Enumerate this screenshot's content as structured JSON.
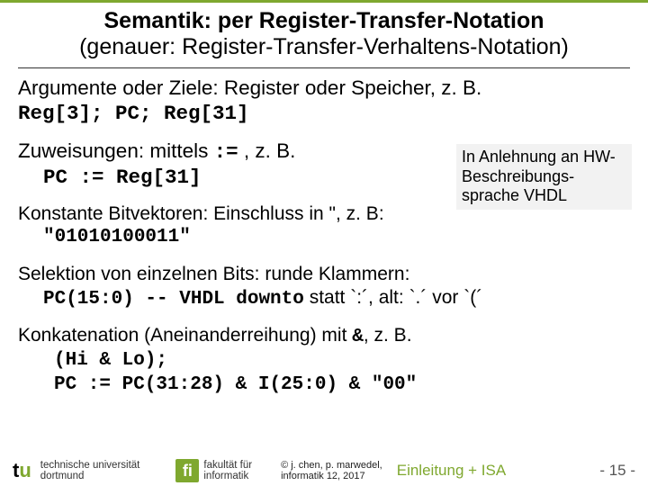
{
  "header": {
    "title": "Semantik: per Register-Transfer-Notation",
    "subtitle": "(genauer: Register-Transfer-Verhaltens-Notation)"
  },
  "body": {
    "args_intro": "Argumente oder Ziele: Register oder Speicher, z. B.",
    "reg_examples": "Reg[3];  PC;   Reg[31]",
    "assign_intro_pre": "Zuweisungen: mittels ",
    "assign_op": ":=",
    "assign_intro_post": " , z. B.",
    "assign_example": "PC := Reg[31]",
    "sidebox": "In Anlehnung an HW-Beschreibungs-sprache VHDL",
    "const_intro": "Konstante Bitvektoren: Einschluss in \", z. B:",
    "const_example": "\"01010100011\"",
    "select_intro": "Selektion von einzelnen Bits:  runde Klammern:",
    "select_code": "PC(15:0)",
    "select_tail_pre": " -- VHDL ",
    "select_downto": "downto",
    "select_tail_post": " statt `:´, alt: `.´ vor `(´",
    "concat_intro_pre": "Konkatenation (Aneinanderreihung) mit ",
    "concat_amp": "&",
    "concat_intro_post": ", z. B.",
    "concat_line1": "(Hi & Lo);",
    "concat_line2": "PC := PC(31:28) & I(25:0) & \"00\""
  },
  "footer": {
    "uni_line1": "technische universität",
    "uni_line2": "dortmund",
    "fak_line1": "fakultät für",
    "fak_line2": "informatik",
    "fi_mark": "fi",
    "copyright_line1": "© j. chen, p. marwedel,",
    "copyright_line2": "informatik 12,  2017",
    "section": "Einleitung + ISA",
    "page": "- 15 -"
  }
}
